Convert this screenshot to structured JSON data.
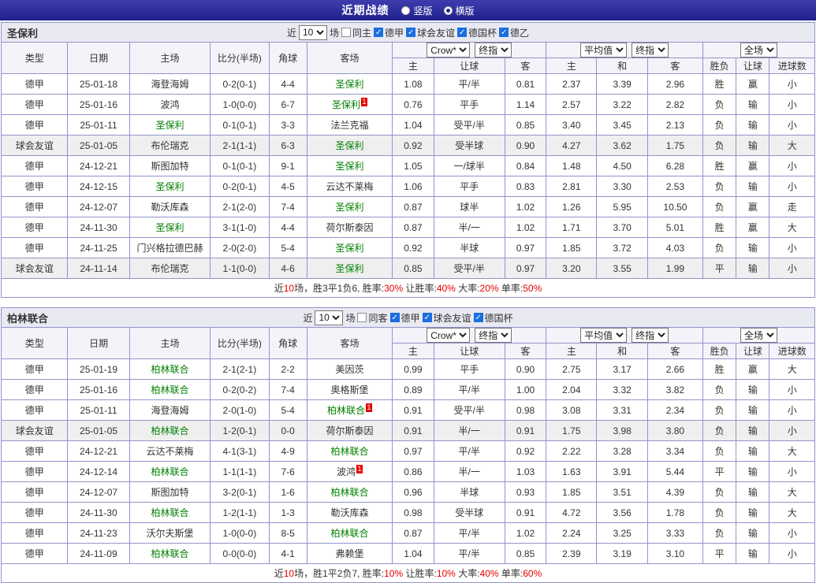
{
  "topbar": {
    "title": "近期战绩",
    "options": [
      {
        "label": "竖版",
        "selected": false
      },
      {
        "label": "横版",
        "selected": true
      }
    ]
  },
  "table_headers": {
    "type": "类型",
    "date": "日期",
    "home": "主场",
    "score": "比分(半场)",
    "corner": "角球",
    "away": "客场",
    "asia_home": "主",
    "asia_handicap": "让球",
    "asia_away": "客",
    "euro_home": "主",
    "euro_draw": "和",
    "euro_away": "客",
    "result": "胜负",
    "handicap_result": "让球",
    "goals": "进球数"
  },
  "colors": {
    "league_type_bg": "#990099",
    "friendly_type_bg": "#2aa7a7",
    "win_red": "#e60000",
    "loss_blue": "#2222cc",
    "draw_green": "#009900",
    "focal_team_green": "#008000",
    "grid_border": "#9393cc",
    "topbar_bg": "#21218b"
  },
  "sections": [
    {
      "team": "圣保利",
      "filters": {
        "prefix": "近",
        "count": "10",
        "suffix": "场",
        "venue": {
          "label": "同主",
          "checked": false
        },
        "leagues": [
          {
            "label": "德甲",
            "checked": true
          },
          {
            "label": "球会友谊",
            "checked": true
          },
          {
            "label": "德国杯",
            "checked": true
          },
          {
            "label": "德乙",
            "checked": true
          }
        ]
      },
      "selects": {
        "asia_source": "Crow*",
        "asia_stage": "终指",
        "euro_source": "平均值",
        "euro_stage": "终指",
        "scope": "全场"
      },
      "rows": [
        {
          "type": "德甲",
          "type_color": "purple",
          "date": "25-01-18",
          "home": "海登海姆",
          "home_focal": false,
          "home_red": 0,
          "score": "0-2(0-1)",
          "corner": "4-4",
          "away": "圣保利",
          "away_focal": true,
          "away_red": 0,
          "asia_home": "1.08",
          "handicap": "平/半",
          "asia_away": "0.81",
          "euro_home": "2.37",
          "euro_draw": "3.39",
          "euro_away": "2.96",
          "result": "胜",
          "result_color": "red",
          "let_result": "赢",
          "let_color": "red",
          "goals": "小",
          "goals_color": "blue",
          "shaded": false
        },
        {
          "type": "德甲",
          "type_color": "purple",
          "date": "25-01-16",
          "home": "波鸿",
          "home_focal": false,
          "home_red": 0,
          "score": "1-0(0-0)",
          "corner": "6-7",
          "away": "圣保利",
          "away_focal": true,
          "away_red": 1,
          "asia_home": "0.76",
          "handicap": "平手",
          "asia_away": "1.14",
          "euro_home": "2.57",
          "euro_draw": "3.22",
          "euro_away": "2.82",
          "result": "负",
          "result_color": "blue",
          "let_result": "输",
          "let_color": "blue",
          "goals": "小",
          "goals_color": "blue",
          "shaded": false
        },
        {
          "type": "德甲",
          "type_color": "purple",
          "date": "25-01-11",
          "home": "圣保利",
          "home_focal": true,
          "home_red": 0,
          "score": "0-1(0-1)",
          "corner": "3-3",
          "away": "法兰克福",
          "away_focal": false,
          "away_red": 0,
          "asia_home": "1.04",
          "handicap": "受平/半",
          "asia_away": "0.85",
          "euro_home": "3.40",
          "euro_draw": "3.45",
          "euro_away": "2.13",
          "result": "负",
          "result_color": "blue",
          "let_result": "输",
          "let_color": "blue",
          "goals": "小",
          "goals_color": "blue",
          "shaded": false
        },
        {
          "type": "球会友谊",
          "type_color": "teal",
          "date": "25-01-05",
          "home": "布伦瑞克",
          "home_focal": false,
          "home_red": 0,
          "score": "2-1(1-1)",
          "corner": "6-3",
          "away": "圣保利",
          "away_focal": true,
          "away_red": 0,
          "asia_home": "0.92",
          "handicap": "受半球",
          "asia_away": "0.90",
          "euro_home": "4.27",
          "euro_draw": "3.62",
          "euro_away": "1.75",
          "result": "负",
          "result_color": "blue",
          "let_result": "输",
          "let_color": "blue",
          "goals": "大",
          "goals_color": "red",
          "shaded": true
        },
        {
          "type": "德甲",
          "type_color": "purple",
          "date": "24-12-21",
          "home": "斯图加特",
          "home_focal": false,
          "home_red": 0,
          "score": "0-1(0-1)",
          "corner": "9-1",
          "away": "圣保利",
          "away_focal": true,
          "away_red": 0,
          "asia_home": "1.05",
          "handicap": "一/球半",
          "asia_away": "0.84",
          "euro_home": "1.48",
          "euro_draw": "4.50",
          "euro_away": "6.28",
          "result": "胜",
          "result_color": "red",
          "let_result": "赢",
          "let_color": "red",
          "goals": "小",
          "goals_color": "blue",
          "shaded": false
        },
        {
          "type": "德甲",
          "type_color": "purple",
          "date": "24-12-15",
          "home": "圣保利",
          "home_focal": true,
          "home_red": 0,
          "score": "0-2(0-1)",
          "corner": "4-5",
          "away": "云达不莱梅",
          "away_focal": false,
          "away_red": 0,
          "asia_home": "1.06",
          "handicap": "平手",
          "asia_away": "0.83",
          "euro_home": "2.81",
          "euro_draw": "3.30",
          "euro_away": "2.53",
          "result": "负",
          "result_color": "blue",
          "let_result": "输",
          "let_color": "blue",
          "goals": "小",
          "goals_color": "blue",
          "shaded": false
        },
        {
          "type": "德甲",
          "type_color": "purple",
          "date": "24-12-07",
          "home": "勒沃库森",
          "home_focal": false,
          "home_red": 0,
          "score": "2-1(2-0)",
          "corner": "7-4",
          "away": "圣保利",
          "away_focal": true,
          "away_red": 0,
          "asia_home": "0.87",
          "handicap": "球半",
          "asia_away": "1.02",
          "euro_home": "1.26",
          "euro_draw": "5.95",
          "euro_away": "10.50",
          "result": "负",
          "result_color": "blue",
          "let_result": "赢",
          "let_color": "red",
          "goals": "走",
          "goals_color": "green",
          "shaded": false
        },
        {
          "type": "德甲",
          "type_color": "purple",
          "date": "24-11-30",
          "home": "圣保利",
          "home_focal": true,
          "home_red": 0,
          "score": "3-1(1-0)",
          "corner": "4-4",
          "away": "荷尔斯泰因",
          "away_focal": false,
          "away_red": 0,
          "asia_home": "0.87",
          "handicap": "半/一",
          "asia_away": "1.02",
          "euro_home": "1.71",
          "euro_draw": "3.70",
          "euro_away": "5.01",
          "result": "胜",
          "result_color": "red",
          "let_result": "赢",
          "let_color": "red",
          "goals": "大",
          "goals_color": "red",
          "shaded": false
        },
        {
          "type": "德甲",
          "type_color": "purple",
          "date": "24-11-25",
          "home": "门兴格拉德巴赫",
          "home_focal": false,
          "home_red": 0,
          "score": "2-0(2-0)",
          "corner": "5-4",
          "away": "圣保利",
          "away_focal": true,
          "away_red": 0,
          "asia_home": "0.92",
          "handicap": "半球",
          "asia_away": "0.97",
          "euro_home": "1.85",
          "euro_draw": "3.72",
          "euro_away": "4.03",
          "result": "负",
          "result_color": "blue",
          "let_result": "输",
          "let_color": "blue",
          "goals": "小",
          "goals_color": "blue",
          "shaded": false
        },
        {
          "type": "球会友谊",
          "type_color": "teal",
          "date": "24-11-14",
          "home": "布伦瑞克",
          "home_focal": false,
          "home_red": 0,
          "score": "1-1(0-0)",
          "corner": "4-6",
          "away": "圣保利",
          "away_focal": true,
          "away_red": 0,
          "asia_home": "0.85",
          "handicap": "受平/半",
          "asia_away": "0.97",
          "euro_home": "3.20",
          "euro_draw": "3.55",
          "euro_away": "1.99",
          "result": "平",
          "result_color": "green",
          "let_result": "输",
          "let_color": "blue",
          "goals": "小",
          "goals_color": "blue",
          "shaded": true
        }
      ],
      "summary": [
        {
          "text": "近",
          "red": false
        },
        {
          "text": "10",
          "red": true
        },
        {
          "text": "场，胜3平1负6, 胜率:",
          "red": false
        },
        {
          "text": "30%",
          "red": true
        },
        {
          "text": " 让胜率:",
          "red": false
        },
        {
          "text": "40%",
          "red": true
        },
        {
          "text": " 大率:",
          "red": false
        },
        {
          "text": "20%",
          "red": true
        },
        {
          "text": " 单率:",
          "red": false
        },
        {
          "text": "50%",
          "red": true
        }
      ]
    },
    {
      "team": "柏林联合",
      "filters": {
        "prefix": "近",
        "count": "10",
        "suffix": "场",
        "venue": {
          "label": "同客",
          "checked": false
        },
        "leagues": [
          {
            "label": "德甲",
            "checked": true
          },
          {
            "label": "球会友谊",
            "checked": true
          },
          {
            "label": "德国杯",
            "checked": true
          }
        ]
      },
      "selects": {
        "asia_source": "Crow*",
        "asia_stage": "终指",
        "euro_source": "平均值",
        "euro_stage": "终指",
        "scope": "全场"
      },
      "rows": [
        {
          "type": "德甲",
          "type_color": "purple",
          "date": "25-01-19",
          "home": "柏林联合",
          "home_focal": true,
          "home_red": 0,
          "score": "2-1(2-1)",
          "corner": "2-2",
          "away": "美因茨",
          "away_focal": false,
          "away_red": 0,
          "asia_home": "0.99",
          "handicap": "平手",
          "asia_away": "0.90",
          "euro_home": "2.75",
          "euro_draw": "3.17",
          "euro_away": "2.66",
          "result": "胜",
          "result_color": "red",
          "let_result": "赢",
          "let_color": "red",
          "goals": "大",
          "goals_color": "red",
          "shaded": false
        },
        {
          "type": "德甲",
          "type_color": "purple",
          "date": "25-01-16",
          "home": "柏林联合",
          "home_focal": true,
          "home_red": 0,
          "score": "0-2(0-2)",
          "corner": "7-4",
          "away": "奥格斯堡",
          "away_focal": false,
          "away_red": 0,
          "asia_home": "0.89",
          "handicap": "平/半",
          "asia_away": "1.00",
          "euro_home": "2.04",
          "euro_draw": "3.32",
          "euro_away": "3.82",
          "result": "负",
          "result_color": "blue",
          "let_result": "输",
          "let_color": "blue",
          "goals": "小",
          "goals_color": "blue",
          "shaded": false
        },
        {
          "type": "德甲",
          "type_color": "purple",
          "date": "25-01-11",
          "home": "海登海姆",
          "home_focal": false,
          "home_red": 0,
          "score": "2-0(1-0)",
          "corner": "5-4",
          "away": "柏林联合",
          "away_focal": true,
          "away_red": 1,
          "asia_home": "0.91",
          "handicap": "受平/半",
          "asia_away": "0.98",
          "euro_home": "3.08",
          "euro_draw": "3.31",
          "euro_away": "2.34",
          "result": "负",
          "result_color": "blue",
          "let_result": "输",
          "let_color": "blue",
          "goals": "小",
          "goals_color": "blue",
          "shaded": false
        },
        {
          "type": "球会友谊",
          "type_color": "teal",
          "date": "25-01-05",
          "home": "柏林联合",
          "home_focal": true,
          "home_red": 0,
          "score": "1-2(0-1)",
          "corner": "0-0",
          "away": "荷尔斯泰因",
          "away_focal": false,
          "away_red": 0,
          "asia_home": "0.91",
          "handicap": "半/一",
          "asia_away": "0.91",
          "euro_home": "1.75",
          "euro_draw": "3.98",
          "euro_away": "3.80",
          "result": "负",
          "result_color": "blue",
          "let_result": "输",
          "let_color": "blue",
          "goals": "小",
          "goals_color": "blue",
          "shaded": true
        },
        {
          "type": "德甲",
          "type_color": "purple",
          "date": "24-12-21",
          "home": "云达不莱梅",
          "home_focal": false,
          "home_red": 0,
          "score": "4-1(3-1)",
          "corner": "4-9",
          "away": "柏林联合",
          "away_focal": true,
          "away_red": 0,
          "asia_home": "0.97",
          "handicap": "平/半",
          "asia_away": "0.92",
          "euro_home": "2.22",
          "euro_draw": "3.28",
          "euro_away": "3.34",
          "result": "负",
          "result_color": "blue",
          "let_result": "输",
          "let_color": "blue",
          "goals": "大",
          "goals_color": "red",
          "shaded": false
        },
        {
          "type": "德甲",
          "type_color": "purple",
          "date": "24-12-14",
          "home": "柏林联合",
          "home_focal": true,
          "home_red": 0,
          "score": "1-1(1-1)",
          "corner": "7-6",
          "away": "波鸿",
          "away_focal": false,
          "away_red": 1,
          "asia_home": "0.86",
          "handicap": "半/一",
          "asia_away": "1.03",
          "euro_home": "1.63",
          "euro_draw": "3.91",
          "euro_away": "5.44",
          "result": "平",
          "result_color": "green",
          "let_result": "输",
          "let_color": "blue",
          "goals": "小",
          "goals_color": "blue",
          "shaded": false
        },
        {
          "type": "德甲",
          "type_color": "purple",
          "date": "24-12-07",
          "home": "斯图加特",
          "home_focal": false,
          "home_red": 0,
          "score": "3-2(0-1)",
          "corner": "1-6",
          "away": "柏林联合",
          "away_focal": true,
          "away_red": 0,
          "asia_home": "0.96",
          "handicap": "半球",
          "asia_away": "0.93",
          "euro_home": "1.85",
          "euro_draw": "3.51",
          "euro_away": "4.39",
          "result": "负",
          "result_color": "blue",
          "let_result": "输",
          "let_color": "blue",
          "goals": "大",
          "goals_color": "red",
          "shaded": false
        },
        {
          "type": "德甲",
          "type_color": "purple",
          "date": "24-11-30",
          "home": "柏林联合",
          "home_focal": true,
          "home_red": 0,
          "score": "1-2(1-1)",
          "corner": "1-3",
          "away": "勒沃库森",
          "away_focal": false,
          "away_red": 0,
          "asia_home": "0.98",
          "handicap": "受半球",
          "asia_away": "0.91",
          "euro_home": "4.72",
          "euro_draw": "3.56",
          "euro_away": "1.78",
          "result": "负",
          "result_color": "blue",
          "let_result": "输",
          "let_color": "blue",
          "goals": "大",
          "goals_color": "red",
          "shaded": false
        },
        {
          "type": "德甲",
          "type_color": "purple",
          "date": "24-11-23",
          "home": "沃尔夫斯堡",
          "home_focal": false,
          "home_red": 0,
          "score": "1-0(0-0)",
          "corner": "8-5",
          "away": "柏林联合",
          "away_focal": true,
          "away_red": 0,
          "asia_home": "0.87",
          "handicap": "平/半",
          "asia_away": "1.02",
          "euro_home": "2.24",
          "euro_draw": "3.25",
          "euro_away": "3.33",
          "result": "负",
          "result_color": "blue",
          "let_result": "输",
          "let_color": "blue",
          "goals": "小",
          "goals_color": "blue",
          "shaded": false
        },
        {
          "type": "德甲",
          "type_color": "purple",
          "date": "24-11-09",
          "home": "柏林联合",
          "home_focal": true,
          "home_red": 0,
          "score": "0-0(0-0)",
          "corner": "4-1",
          "away": "弗赖堡",
          "away_focal": false,
          "away_red": 0,
          "asia_home": "1.04",
          "handicap": "平/半",
          "asia_away": "0.85",
          "euro_home": "2.39",
          "euro_draw": "3.19",
          "euro_away": "3.10",
          "result": "平",
          "result_color": "green",
          "let_result": "输",
          "let_color": "blue",
          "goals": "小",
          "goals_color": "blue",
          "shaded": false
        }
      ],
      "summary": [
        {
          "text": "近",
          "red": false
        },
        {
          "text": "10",
          "red": true
        },
        {
          "text": "场，胜1平2负7, 胜率:",
          "red": false
        },
        {
          "text": "10%",
          "red": true
        },
        {
          "text": " 让胜率:",
          "red": false
        },
        {
          "text": "10%",
          "red": true
        },
        {
          "text": " 大率:",
          "red": false
        },
        {
          "text": "40%",
          "red": true
        },
        {
          "text": " 单率:",
          "red": false
        },
        {
          "text": "60%",
          "red": true
        }
      ]
    }
  ]
}
